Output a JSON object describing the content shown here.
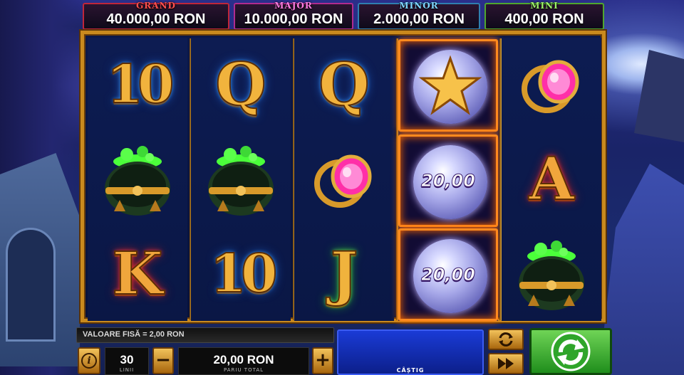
{
  "jackpots": [
    {
      "label": "GRAND",
      "value": "40.000,00 RON"
    },
    {
      "label": "MAJOR",
      "value": "10.000,00 RON"
    },
    {
      "label": "MINOR",
      "value": "2.000,00 RON"
    },
    {
      "label": "MINI",
      "value": "400,00 RON"
    }
  ],
  "reels": [
    [
      "10",
      "cauldron-icon",
      "K"
    ],
    [
      "Q",
      "cauldron-icon",
      "10"
    ],
    [
      "Q",
      "ring-icon",
      "J"
    ],
    [
      "star-orb-icon",
      "20,00",
      "20,00"
    ],
    [
      "ring-icon",
      "A",
      "cauldron-icon"
    ]
  ],
  "controls": {
    "coin_value": "VALOARE FISĂ = 2,00 RON",
    "lines_value": "30",
    "lines_label": "LINII",
    "minus_label": "−",
    "plus_label": "+",
    "bet_value": "20,00 RON",
    "bet_label": "PARIU TOTAL",
    "win_label": "CÂȘTIG",
    "info_label": "i"
  },
  "colors": {
    "frame": "#c98a1e",
    "highlight": "#ff8a1e",
    "spin": "#3fb33a"
  }
}
